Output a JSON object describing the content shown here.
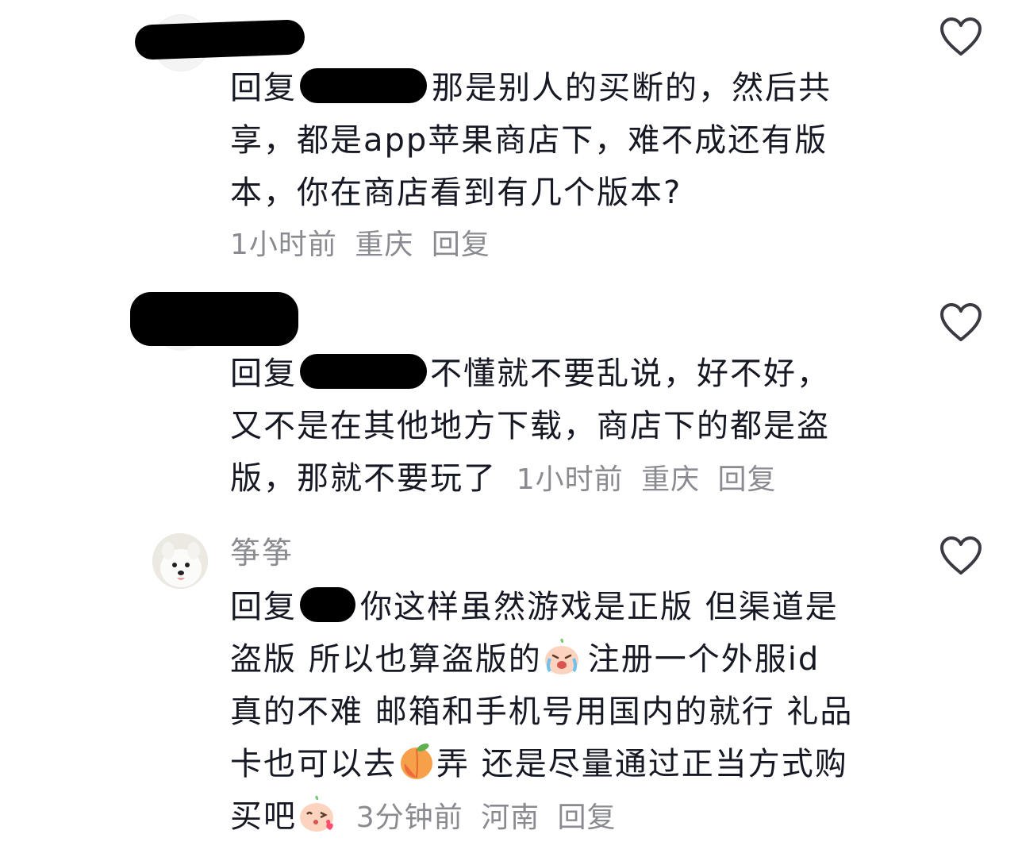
{
  "comments": [
    {
      "reply_prefix": "回复",
      "text_line1": "那是别人的买断的，然后共",
      "text_line2": "享，都是app苹果商店下，难不成还有版",
      "text_line3": "本，你在商店看到有几个版本?",
      "time": "1小时前",
      "location": "重庆",
      "reply_label": "回复"
    },
    {
      "reply_prefix": "回复",
      "text_line1": "不懂就不要乱说，好不好，",
      "text_line2": "又不是在其他地方下载，商店下的都是盗",
      "text_line3": "版，那就不要玩了",
      "time": "1小时前",
      "location": "重庆",
      "reply_label": "回复"
    },
    {
      "username": "筝筝",
      "reply_prefix": "回复",
      "text_line1": "你这样虽然游戏是正版 但渠道是",
      "text_line2a": "盗版 所以也算盗版的",
      "text_line2b": "注册一个外服id",
      "text_line3": "真的不难 邮箱和手机号用国内的就行 礼品",
      "text_line4a": "卡也可以去",
      "text_line4b": "弄 还是尽量通过正当方式购",
      "text_line5": "买吧",
      "time": "3分钟前",
      "location": "河南",
      "reply_label": "回复"
    }
  ],
  "icons": {
    "like": "heart-outline-icon",
    "emoji_cry": "crying-face-emoji",
    "emoji_peach": "peach-emoji",
    "emoji_kiss": "kiss-face-emoji"
  },
  "colors": {
    "text": "#161823",
    "meta": "#8a8b91",
    "background": "#ffffff"
  }
}
